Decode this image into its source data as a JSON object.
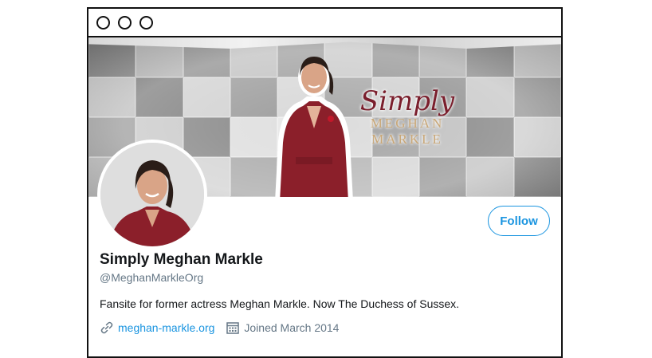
{
  "window": {
    "controls": [
      "window-dot",
      "window-dot",
      "window-dot"
    ]
  },
  "banner": {
    "script_text": "Simply",
    "caps_line1": "MEGHAN",
    "caps_line2": "MARKLE"
  },
  "profile": {
    "follow_label": "Follow",
    "display_name": "Simply Meghan Markle",
    "handle": "@MeghanMarkleOrg",
    "bio": "Fansite for former actress Meghan Markle. Now The Duchess of Sussex.",
    "website": "meghan-markle.org",
    "joined": "Joined March 2014"
  },
  "colors": {
    "accent": "#1b95e0",
    "dress": "#8b1f2a",
    "muted": "#657786"
  },
  "icons": {
    "website": "link-icon",
    "joined": "calendar-icon"
  }
}
